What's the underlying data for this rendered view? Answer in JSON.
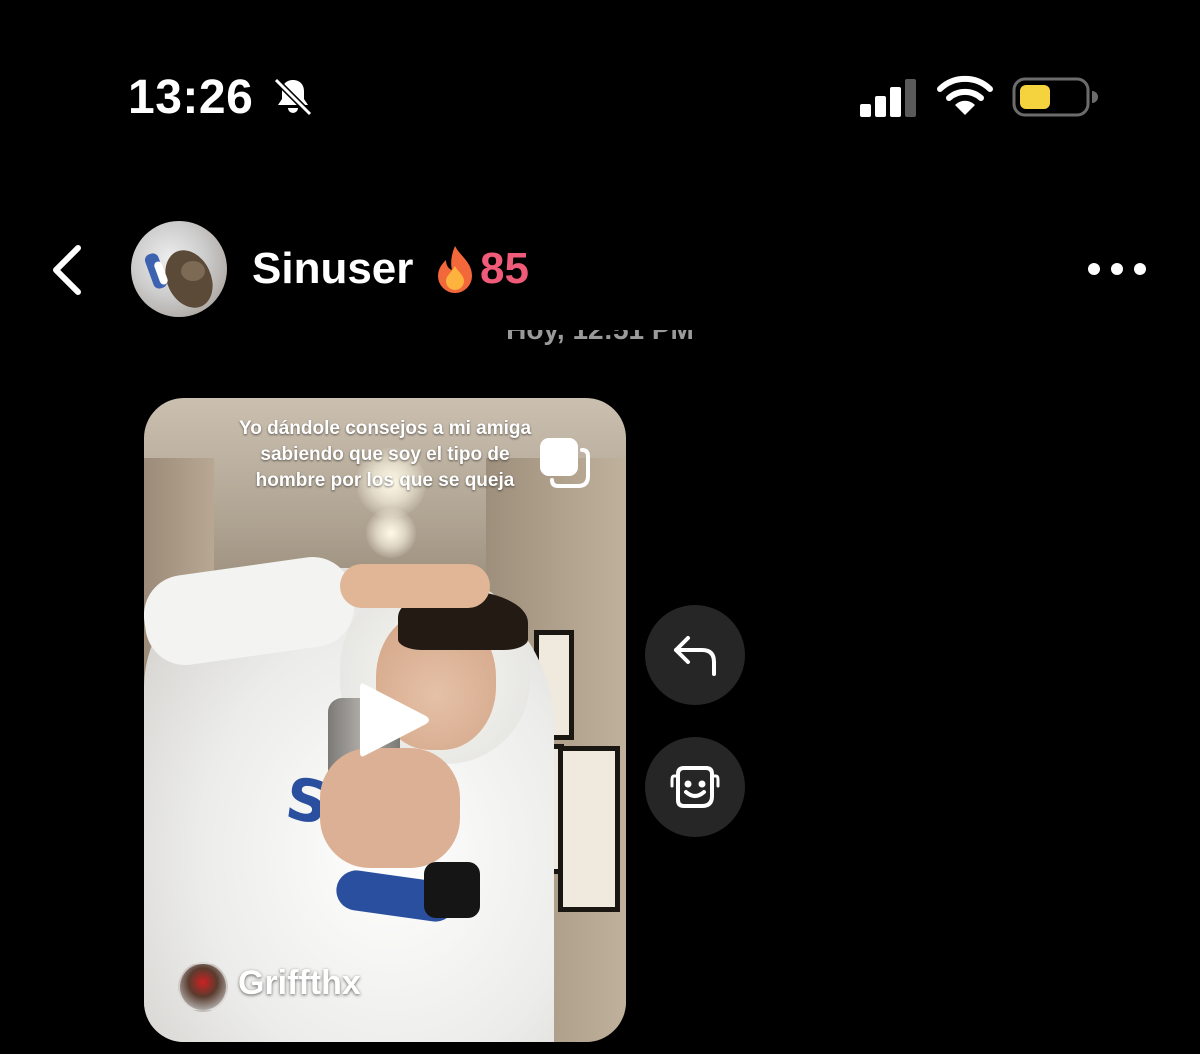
{
  "status_bar": {
    "time": "13:26",
    "icons": [
      "bell-muted-icon",
      "signal-icon",
      "wifi-icon",
      "battery-icon"
    ],
    "battery_color": "#f5d33e"
  },
  "header": {
    "contact_name": "Sinuser",
    "streak_count": "85",
    "streak_color": "#ef5b79",
    "icons": [
      "back-icon",
      "fire-icon",
      "more-icon"
    ]
  },
  "conversation": {
    "timestamp": "Hoy, 12:51 PM"
  },
  "shared_reel": {
    "caption": "Yo dándole consejos a mi amiga sabiendo que soy el tipo de hombre por los que se queja",
    "author_name": "Griffthx",
    "icons": [
      "carousel-icon",
      "play-icon"
    ]
  },
  "actions": {
    "icons": [
      "reply-icon",
      "sticker-icon"
    ]
  }
}
